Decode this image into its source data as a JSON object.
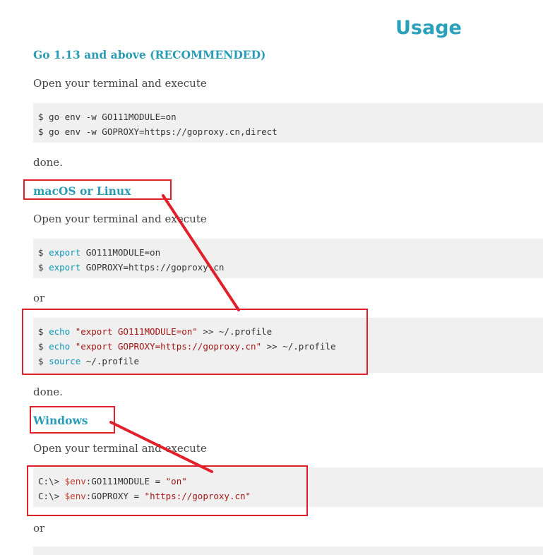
{
  "title": "Usage",
  "go113": {
    "heading": "Go 1.13 and above (RECOMMENDED)",
    "intro": "Open your terminal and execute",
    "code": {
      "l1": "$ go env -w GO111MODULE=on",
      "l2": "$ go env -w GOPROXY=https://goproxy.cn,direct"
    },
    "done": "done."
  },
  "unix": {
    "heading": "macOS or Linux",
    "intro": "Open your terminal and execute",
    "code1": {
      "l1": {
        "prompt": "$ ",
        "kw": "export",
        "rest": " GO111MODULE=on"
      },
      "l2": {
        "prompt": "$ ",
        "kw": "export",
        "rest": " GOPROXY=https://goproxy.cn"
      }
    },
    "or": "or",
    "code2": {
      "l1": {
        "prompt": "$ ",
        "kw": "echo",
        "sp": " ",
        "str": "\"export GO111MODULE=on\"",
        "rest": " >> ~/.profile"
      },
      "l2": {
        "prompt": "$ ",
        "kw": "echo",
        "sp": " ",
        "str": "\"export GOPROXY=https://goproxy.cn\"",
        "rest": " >> ~/.profile"
      },
      "l3": {
        "prompt": "$ ",
        "kw": "source",
        "rest": " ~/.profile"
      }
    },
    "done": "done."
  },
  "windows": {
    "heading": "Windows",
    "intro": "Open your terminal and execute",
    "code": {
      "l1": {
        "prompt": "C:\\> ",
        "var": "$env",
        "mid": ":GO111MODULE = ",
        "str": "\"on\""
      },
      "l2": {
        "prompt": "C:\\> ",
        "var": "$env",
        "mid": ":GOPROXY = ",
        "str": "\"https://goproxy.cn\""
      }
    },
    "or": "or"
  },
  "annotations": {
    "color": "#e0202a"
  }
}
